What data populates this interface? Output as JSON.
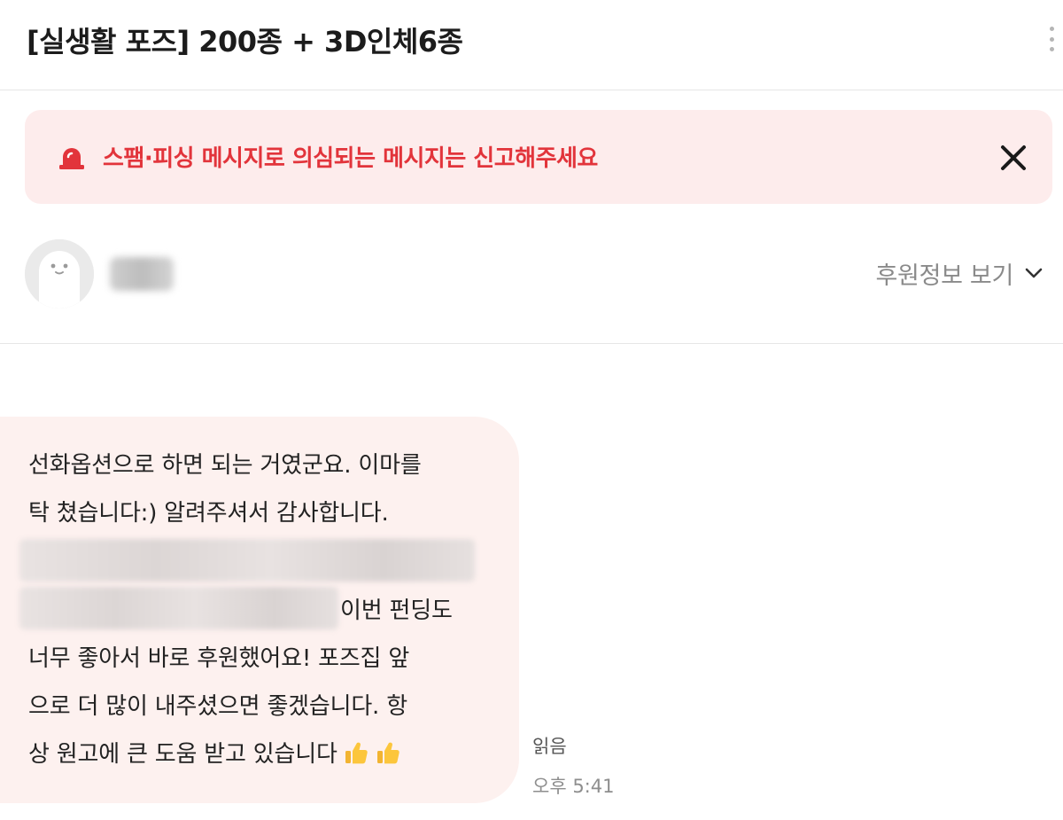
{
  "header": {
    "title": "[실생활 포즈] 200종 + 3D인체6종",
    "more_icon": "kebab-menu-icon"
  },
  "warning": {
    "text": "스팸·피싱 메시지로 의심되는 메시지는 신고해주세요",
    "icon": "siren-icon",
    "close_icon": "close-icon",
    "color": "#e2343b",
    "background": "#fdecec"
  },
  "sender": {
    "name_redacted": true,
    "sponsor_info_label": "후원정보 보기",
    "chevron_icon": "chevron-down-icon"
  },
  "message": {
    "lines": {
      "l1": "선화옵션으로 하면 되는 거였군요. 이마를",
      "l2": "탁 쳤습니다:) 알려주셔서 감사합니다.",
      "l4_tail": "이번 펀딩도",
      "l5": "너무 좋아서 바로 후원했어요! 포즈집 앞",
      "l6": "으로 더 많이 내주셨으면 좋겠습니다. 항",
      "l7": "상 원고에 큰 도움 받고 있습니다"
    },
    "emoji": "thumbs-up-icon",
    "redacted_segments": 2,
    "bubble_color": "#fdf1ef",
    "read_status": "읽음",
    "time": "오후 5:41"
  }
}
